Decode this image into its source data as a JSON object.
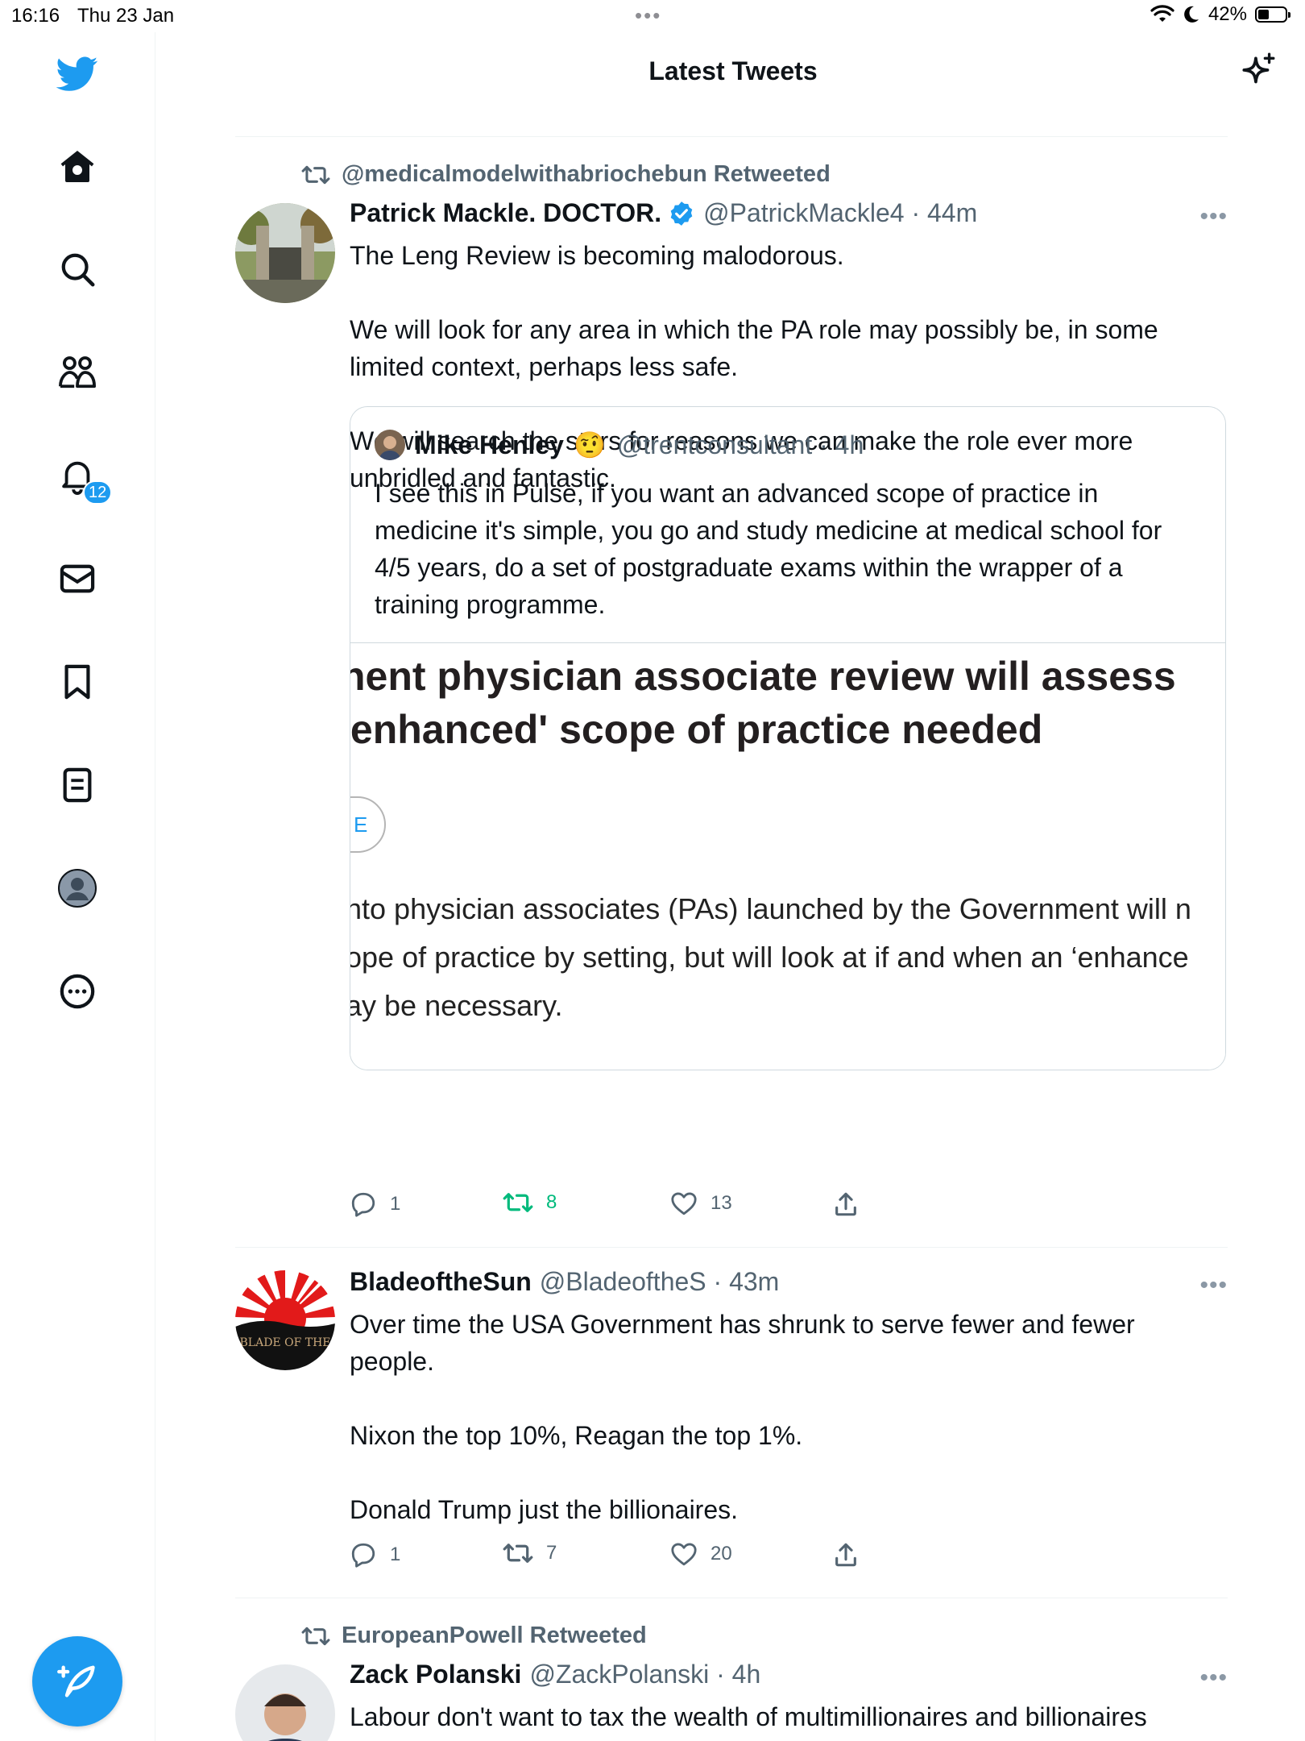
{
  "status_bar": {
    "time": "16:16",
    "date": "Thu 23 Jan",
    "battery": "42%",
    "battery_level": 0.42
  },
  "header": {
    "title": "Latest Tweets"
  },
  "sidebar": {
    "notifications_badge": "12"
  },
  "tweets": [
    {
      "retweeted_by": "@medicalmodelwithabriochebun Retweeted",
      "name": "Patrick Mackle. DOCTOR.",
      "handle": "@PatrickMackle4 · 44m",
      "text": "The Leng Review is becoming malodorous.\n\nWe will look for any area in which the PA role may possibly be, in some limited context, perhaps less safe.\n\nWe will search the stars for reasons we can make the role ever more unbridled and fantastic.",
      "quote": {
        "name": "Mike Henley",
        "emoji": "🤨",
        "handle": "@trentconsultant · 4h",
        "text": "I see this in Pulse, if you want an advanced scope of practice in medicine it's simple, you go and study medicine at medical school for 4/5 years, do a set of postgraduate exams within the wrapper of a training programme.",
        "media_headline": "nent physician associate review will assess\n'enhanced' scope of practice needed",
        "media_circle": "E",
        "media_body": "nto physician associates (PAs) launched by the Government will n\nope of practice by setting, but will look at if and when an ‘enhance\nay be necessary."
      },
      "replies": "1",
      "retweets": "8",
      "likes": "13"
    },
    {
      "name": "BladeoftheSun",
      "handle": "@BladeoftheS · 43m",
      "avatar_text": "BLADE\nOF THE",
      "text": "Over time the USA Government has shrunk to serve fewer and fewer people.\n\nNixon the top 10%, Reagan the top 1%.\n\nDonald Trump just the billionaires.",
      "replies": "1",
      "retweets": "7",
      "likes": "20"
    },
    {
      "retweeted_by": "EuropeanPowell Retweeted",
      "name": "Zack Polanski",
      "handle": "@ZackPolanski · 4h",
      "text": "Labour don't want to tax the wealth of multimillionaires and billionaires"
    }
  ],
  "colors": {
    "brand": "#1d9bf0",
    "retweet_active": "#00ba7c",
    "muted": "#536471"
  }
}
